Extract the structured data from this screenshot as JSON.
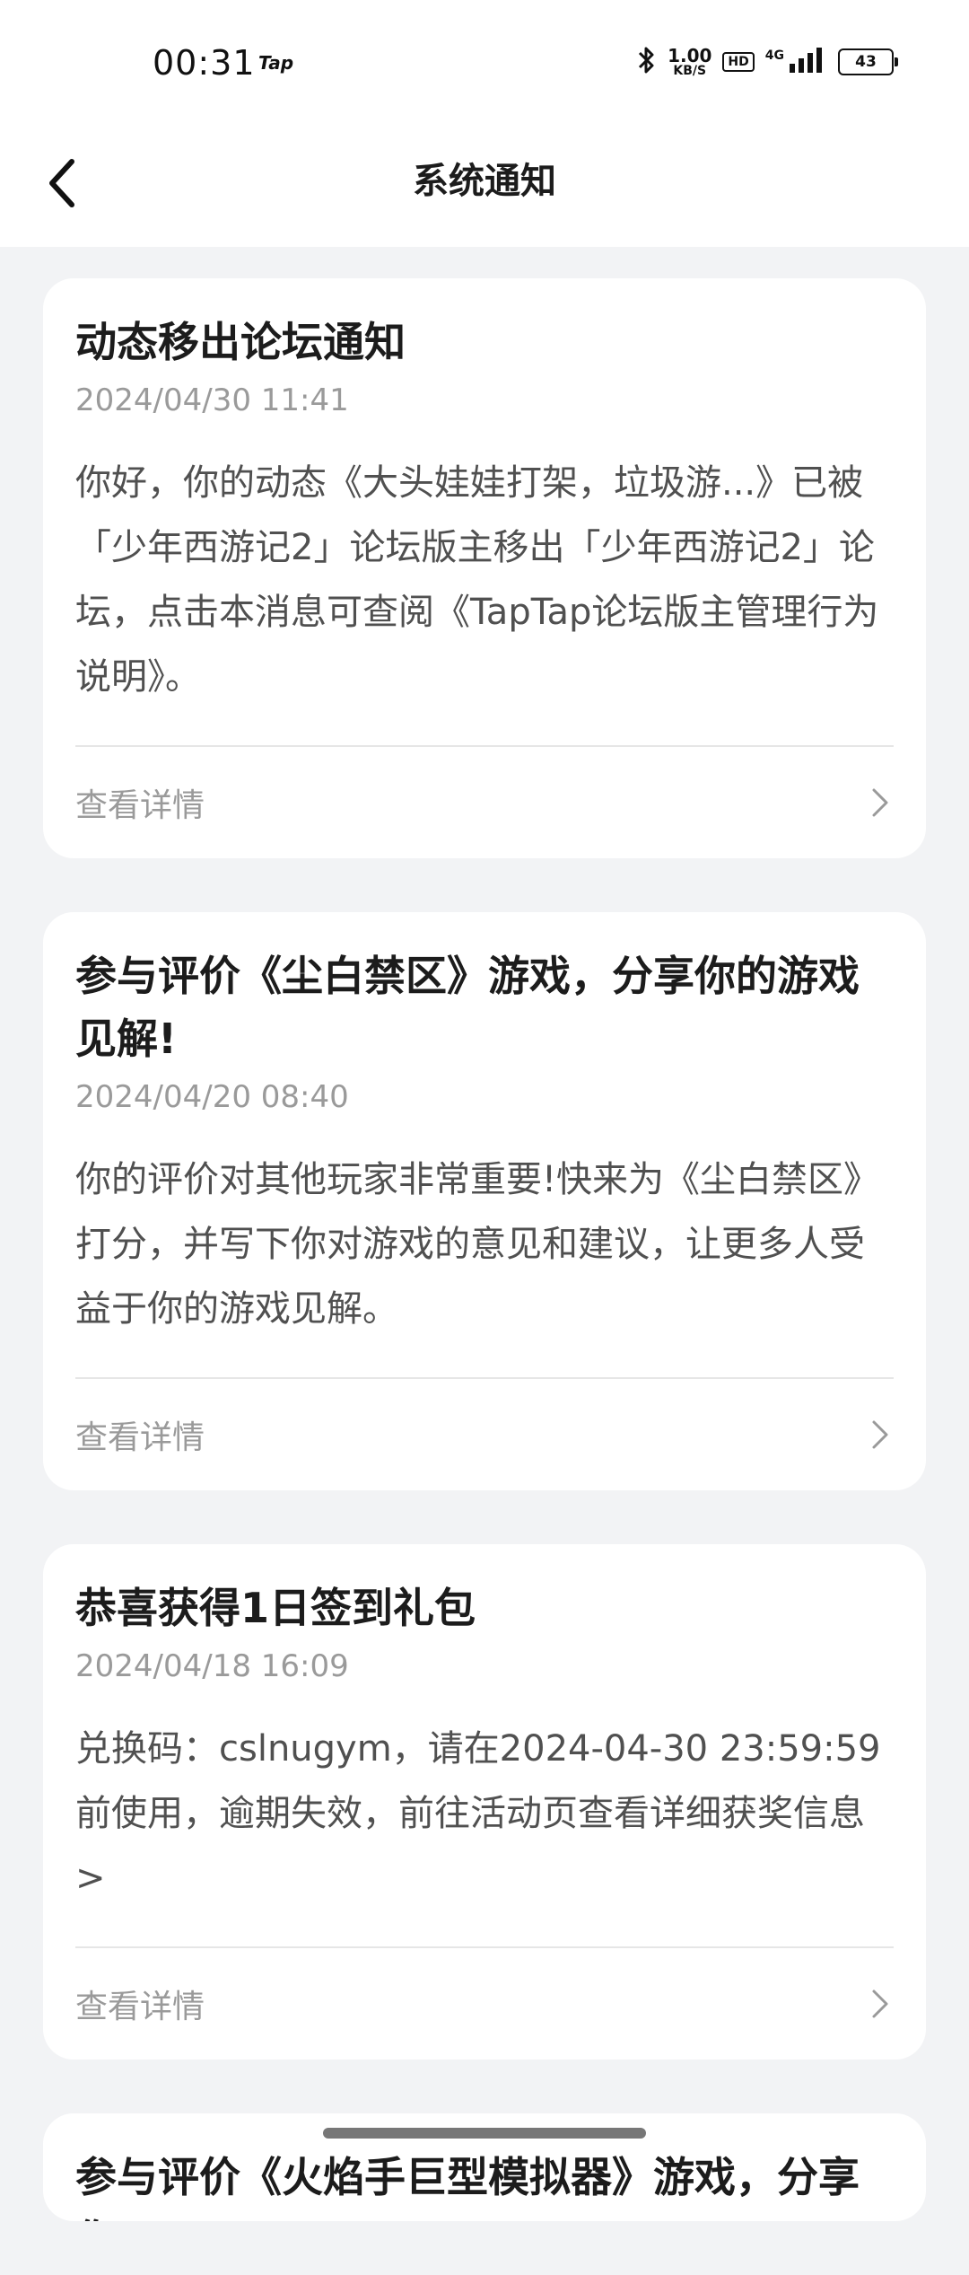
{
  "status_bar": {
    "time": "00:31",
    "app_label": "Tap",
    "net_speed_value": "1.00",
    "net_speed_unit": "KB/S",
    "hd_label": "HD",
    "network_label": "4G",
    "battery_level": "43",
    "icons": [
      "bluetooth-icon",
      "signal-icon",
      "battery-icon"
    ]
  },
  "header": {
    "title": "系统通知",
    "back_icon": "chevron-left-icon"
  },
  "notifications": [
    {
      "title": "动态移出论坛通知",
      "time": "2024/04/30 11:41",
      "body": "你好，你的动态《大头娃娃打架，垃圾游...》已被「少年西游记2」论坛版主移出「少年西游记2」论坛，点击本消息可查阅《TapTap论坛版主管理行为说明》。",
      "action": "查看详情"
    },
    {
      "title": "参与评价《尘白禁区》游戏，分享你的游戏见解!",
      "time": "2024/04/20 08:40",
      "body": "你的评价对其他玩家非常重要!快来为《尘白禁区》打分，并写下你对游戏的意见和建议，让更多人受益于你的游戏见解。",
      "action": "查看详情"
    },
    {
      "title": "恭喜获得1日签到礼包",
      "time": "2024/04/18 16:09",
      "body": "兑换码：cslnugym，请在2024-04-30 23:59:59前使用，逾期失效，前往活动页查看详细获奖信息>",
      "action": "查看详情"
    },
    {
      "title": "参与评价《火焰手巨型模拟器》游戏，分享你",
      "time": "",
      "body": "",
      "action": ""
    }
  ]
}
